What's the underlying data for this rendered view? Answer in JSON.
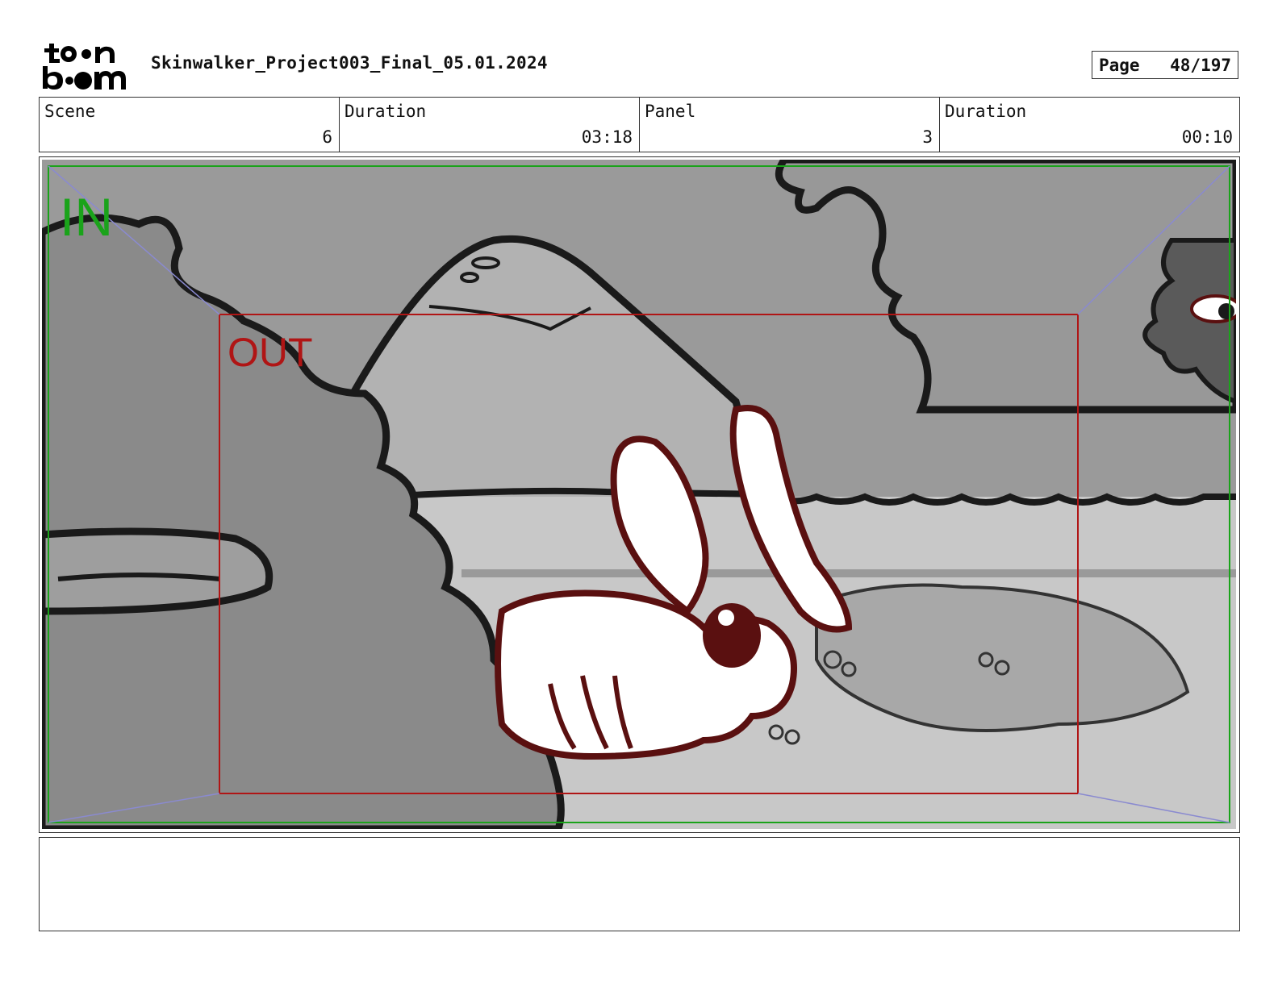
{
  "header": {
    "logo_top": "toon",
    "logo_bottom": "boom",
    "project_title": "Skinwalker_Project003_Final_05.01.2024",
    "page_label": "Page",
    "page_value": "48/197"
  },
  "info": {
    "scene_label": "Scene",
    "scene_value": "6",
    "scene_duration_label": "Duration",
    "scene_duration_value": "03:18",
    "panel_label": "Panel",
    "panel_value": "3",
    "panel_duration_label": "Duration",
    "panel_duration_value": "00:10"
  },
  "camera": {
    "in_label": "IN",
    "out_label": "OUT",
    "in_color": "#1aa31a",
    "out_color": "#b01515",
    "guide_color": "#8a8ad0"
  },
  "notes": {
    "text": ""
  }
}
